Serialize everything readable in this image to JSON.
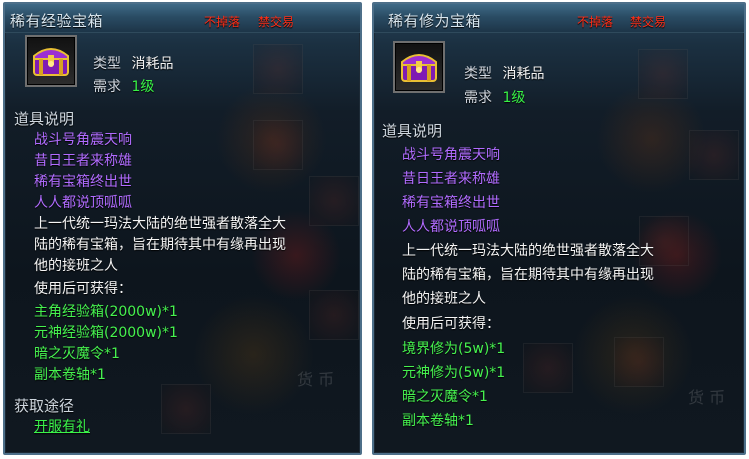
{
  "panels": [
    {
      "title": "稀有经验宝箱",
      "badges": [
        "不掉落",
        "禁交易"
      ],
      "meta": {
        "type_label": "类型",
        "type_value": "消耗品",
        "need_label": "需求",
        "need_value": "1级"
      },
      "description_title": "道具说明",
      "poem": [
        "战斗号角震天响",
        "昔日王者来称雄",
        "稀有宝箱终出世",
        "人人都说顶呱呱"
      ],
      "description": [
        "上一代统一玛法大陆的绝世强者散落全大",
        "陆的稀有宝箱，旨在期待其中有缘再出现",
        "他的接班之人"
      ],
      "obtain_label": "使用后可获得：",
      "rewards": [
        "主角经验箱(2000w)*1",
        "元神经验箱(2000w)*1",
        "暗之灭魔令*1",
        "副本卷轴*1"
      ],
      "source_title": "获取途径",
      "source_link": "开服有礼"
    },
    {
      "title": "稀有修为宝箱",
      "badges": [
        "不掉落",
        "禁交易"
      ],
      "meta": {
        "type_label": "类型",
        "type_value": "消耗品",
        "need_label": "需求",
        "need_value": "1级"
      },
      "description_title": "道具说明",
      "poem": [
        "战斗号角震天响",
        "昔日王者来称雄",
        "稀有宝箱终出世",
        "人人都说顶呱呱"
      ],
      "description": [
        "上一代统一玛法大陆的绝世强者散落全大",
        "陆的稀有宝箱，旨在期待其中有缘再出现",
        "他的接班之人"
      ],
      "obtain_label": "使用后可获得：",
      "rewards": [
        "境界修为(5w)*1",
        "元神修为(5w)*1",
        "暗之灭魔令*1",
        "副本卷轴*1"
      ]
    }
  ]
}
